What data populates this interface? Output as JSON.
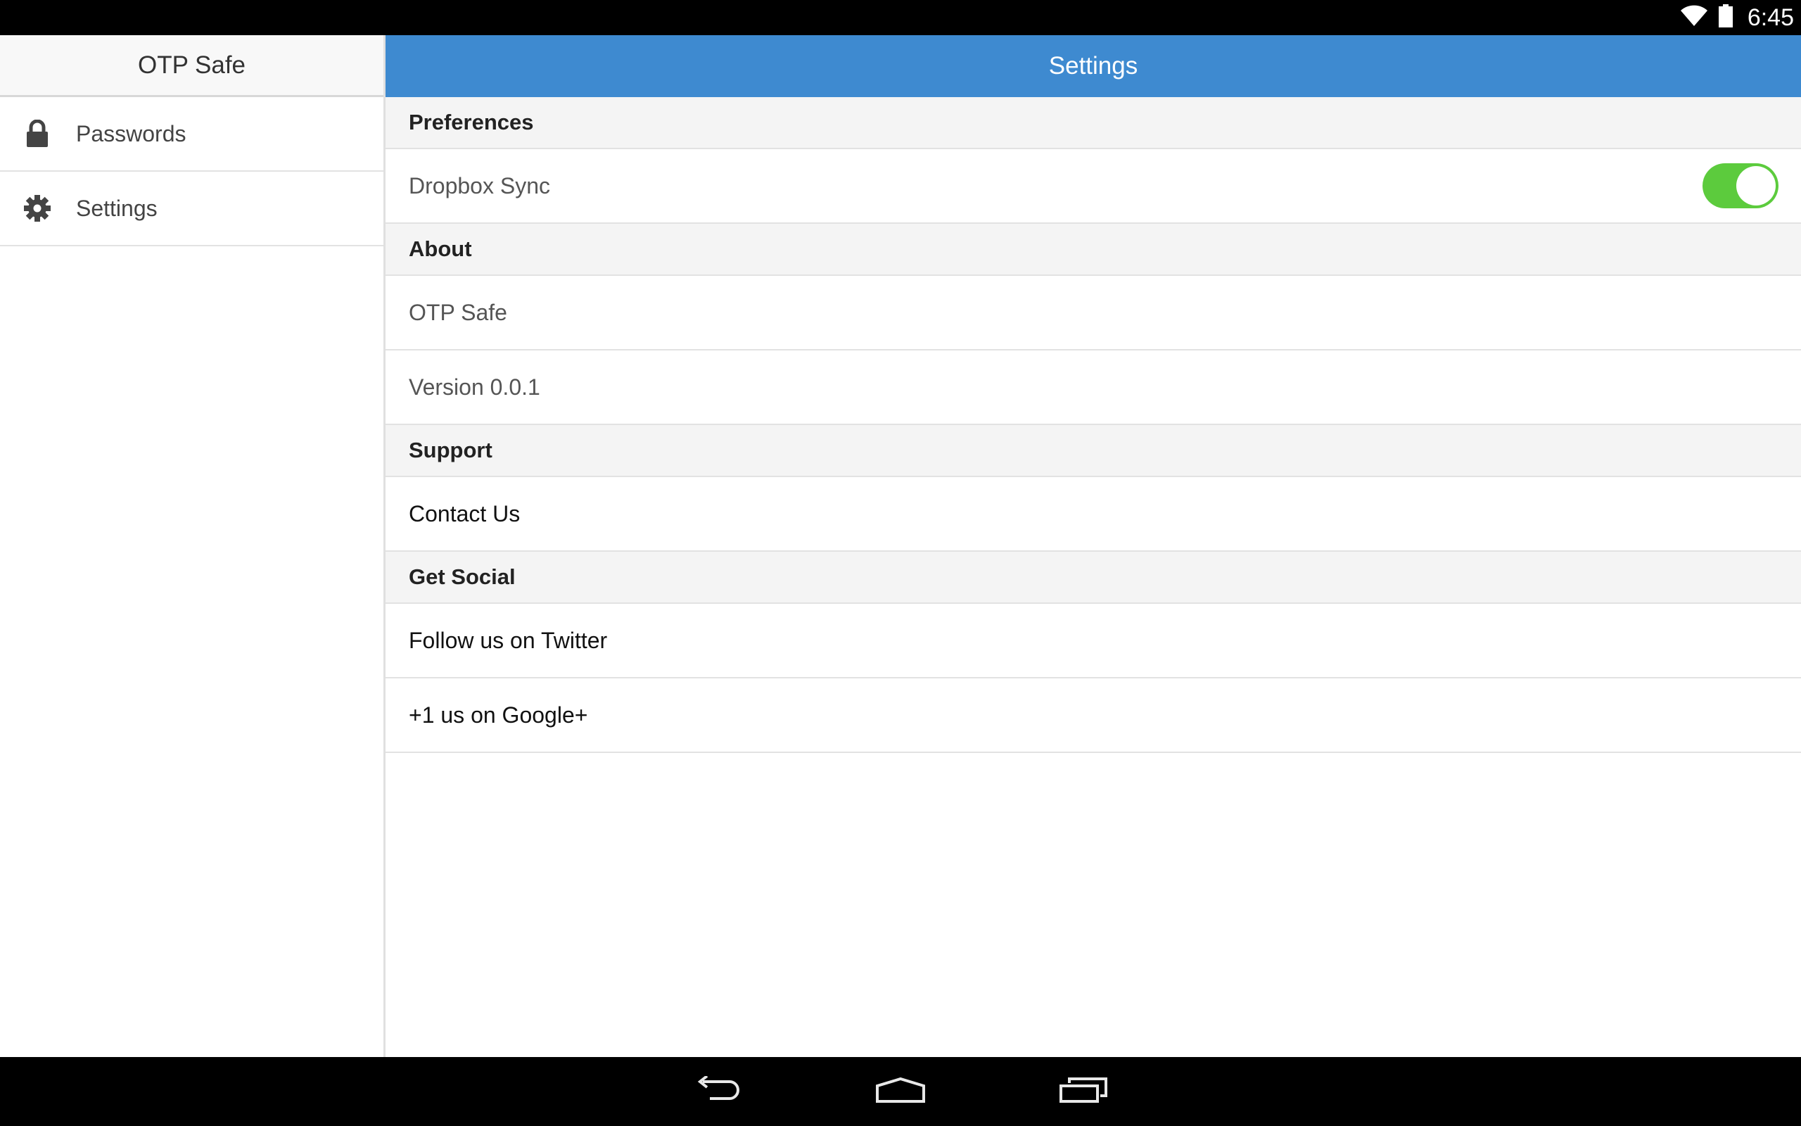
{
  "status_bar": {
    "time": "6:45",
    "icons": [
      "wifi-icon",
      "battery-icon"
    ]
  },
  "sidebar": {
    "title": "OTP Safe",
    "items": [
      {
        "label": "Passwords",
        "icon": "lock-icon"
      },
      {
        "label": "Settings",
        "icon": "gear-icon"
      }
    ]
  },
  "main": {
    "title": "Settings",
    "sections": [
      {
        "header": "Preferences",
        "rows": [
          {
            "label": "Dropbox Sync",
            "toggle": true
          }
        ]
      },
      {
        "header": "About",
        "rows": [
          {
            "label": "OTP Safe"
          },
          {
            "label": "Version 0.0.1"
          }
        ]
      },
      {
        "header": "Support",
        "rows": [
          {
            "label": "Contact Us"
          }
        ]
      },
      {
        "header": "Get Social",
        "rows": [
          {
            "label": "Follow us on Twitter"
          },
          {
            "label": "+1 us on Google+"
          }
        ]
      }
    ]
  },
  "nav_bar": {
    "buttons": [
      "back-icon",
      "home-icon",
      "recent-apps-icon"
    ]
  },
  "colors": {
    "accent": "#3e8ad0",
    "toggle_on": "#5ccb3d"
  }
}
